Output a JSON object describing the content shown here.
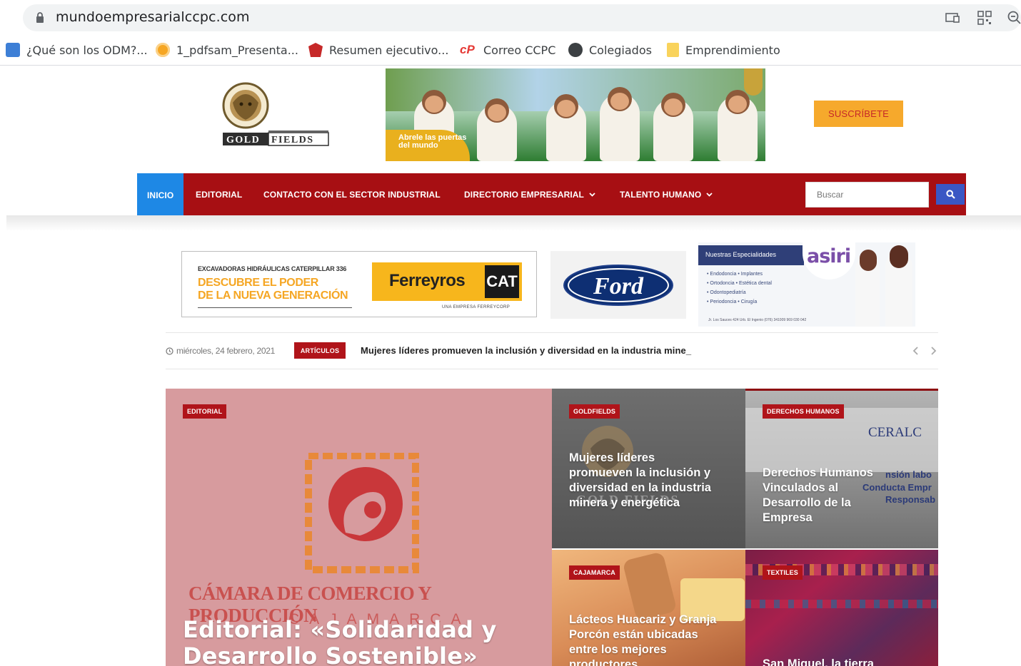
{
  "browser": {
    "url": "mundoempresarialccpc.com",
    "bookmarks": [
      {
        "label": "¿Qué son los ODM?...",
        "icon": "document-icon"
      },
      {
        "label": "1_pdfsam_Presenta...",
        "icon": "pdf-icon"
      },
      {
        "label": "Resumen ejecutivo...",
        "icon": "shield-crest-icon"
      },
      {
        "label": "Correo CCPC",
        "icon": "cp-logo-icon"
      },
      {
        "label": "Colegiados",
        "icon": "globe-icon"
      },
      {
        "label": "Emprendimiento",
        "icon": "folder-icon"
      }
    ]
  },
  "header": {
    "logo_text": "GOLD FIELDS",
    "banner_text": "Abrele las puertas del mundo",
    "subscribe_label": "SUSCRÍBETE"
  },
  "nav": {
    "items": [
      {
        "label": "INICIO",
        "active": true
      },
      {
        "label": "EDITORIAL"
      },
      {
        "label": "CONTACTO CON EL SECTOR INDUSTRIAL"
      },
      {
        "label": "DIRECTORIO EMPRESARIAL",
        "dropdown": true
      },
      {
        "label": "TALENTO HUMANO",
        "dropdown": true
      }
    ],
    "search_placeholder": "Buscar"
  },
  "ads": {
    "ferreyros": {
      "small": "EXCAVADORAS HIDRÁULICAS CATERPILLAR 336",
      "line1": "DESCUBRE EL PODER",
      "line2": "DE LA NUEVA GENERACIÓN",
      "brand": "Ferreyros",
      "cat": "CAT",
      "sub": "UNA EMPRESA FERREYCORP"
    },
    "ford": {
      "brand": "Ford"
    },
    "asiri": {
      "heading": "Nuestras Especialidades",
      "logo": "asiri",
      "services": [
        "• Endodoncia   • Implantes",
        "• Ortodoncia   • Estética dental",
        "• Odontopediatría",
        "• Periodoncia   • Cirugía"
      ],
      "footer": "Jr. Los Sauces 424 Urb. El Ingenio   (076) 341009   969 030 042"
    }
  },
  "ticker": {
    "date": "miércoles, 24 febrero, 2021",
    "badge": "ARTÍCULOS",
    "headline": "Mujeres líderes promueven la inclusión y diversidad en la industria mine_"
  },
  "articles": {
    "main": {
      "category": "EDITORIAL",
      "image_text_1": "CÁMARA DE COMERCIO Y PRODUCCIÓN",
      "image_text_2": "CAJAMARCA",
      "title": "Editorial: «Solidaridad y Desarrollo Sostenible»"
    },
    "gold": {
      "category": "GOLDFIELDS",
      "image_text": "GOLD FIELDS",
      "title": "Mujeres líderes promueven la inclusión y diversidad en la industria minera y energética"
    },
    "dh": {
      "category": "DERECHOS HUMANOS",
      "image_text_1": "CERALC",
      "image_text_2": "nsión labo",
      "image_text_3": "Conducta Empr",
      "image_text_4": "Responsab",
      "title": "Derechos Humanos Vinculados al Desarrollo de la Empresa"
    },
    "lact": {
      "category": "CAJAMARCA",
      "title": "Lácteos Huacariz y Granja Porcón están ubicadas entre los mejores productores"
    },
    "text": {
      "category": "TEXTILES",
      "title": "San Miguel, la tierra"
    }
  }
}
